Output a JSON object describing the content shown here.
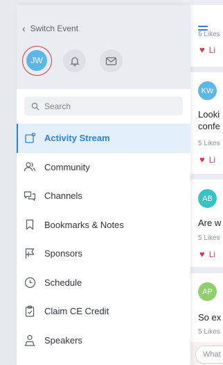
{
  "drawer": {
    "switch_event": "Switch Event",
    "avatar_initials": "JW",
    "search_placeholder": "Search",
    "menu": [
      {
        "label": "Activity Stream",
        "icon": "activity-stream-icon",
        "active": true
      },
      {
        "label": "Community",
        "icon": "community-icon"
      },
      {
        "label": "Channels",
        "icon": "channels-icon"
      },
      {
        "label": "Bookmarks & Notes",
        "icon": "bookmark-icon"
      },
      {
        "label": "Sponsors",
        "icon": "flag-icon"
      },
      {
        "label": "Schedule",
        "icon": "clock-icon"
      },
      {
        "label": "Claim CE Credit",
        "icon": "clipboard-check-icon"
      },
      {
        "label": "Speakers",
        "icon": "speaker-icon"
      }
    ]
  },
  "feed": {
    "posts": [
      {
        "likes": "6 Likes",
        "like_label": "Li"
      },
      {
        "initials": "KW",
        "avatar_color": "#5cb6e8",
        "text_lines": [
          "Looki",
          "confe"
        ],
        "likes": "5 Likes",
        "like_label": "Li"
      },
      {
        "initials": "AB",
        "avatar_color": "#36c2c2",
        "text_lines": [
          "Are w"
        ],
        "likes": "5 Likes",
        "like_label": "Li"
      },
      {
        "initials": "AP",
        "avatar_color": "#8fcf6f",
        "text_lines": [
          "So ex"
        ],
        "likes": "5 Likes"
      }
    ],
    "compose_placeholder": "What"
  },
  "colors": {
    "accent": "#2f7fd3",
    "like": "#e0344b",
    "avatar_ring": "#d83a3a"
  }
}
